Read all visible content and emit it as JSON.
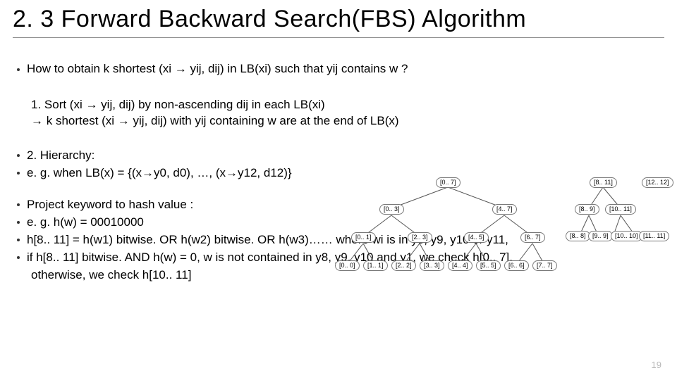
{
  "title": "2. 3 Forward Backward Search(FBS) Algorithm",
  "lead": "How to obtain k shortest (xi → yij, dij) in LB(xi) such that yij contains w ?",
  "para1_line1": "1.  Sort (xi → yij, dij) by non-ascending dij in each LB(xi)",
  "para1_line2": "→ k shortest (xi → yij, dij) with yij containing w are at the end of LB(x)",
  "b1": "2.  Hierarchy:",
  "b2": "e. g. when LB(x) = {(x→y0, d0), …, (x→y12, d12)}",
  "b3": "Project keyword to hash value :",
  "b4": "e. g. h(w) = 00010000",
  "b5": "h[8.. 11] = h(w1) bitwise. OR h(w2) bitwise. OR h(w3)…… where wi is in y8, y9, y10 or y11,",
  "b6": "if h[8.. 11] bitwise. AND h(w) = 0, w is not contained in y8, y9, y10 and y1, we check h[0.. 7],",
  "b6b": "otherwise, we check h[10.. 11]",
  "pagenum": "19",
  "tree1": {
    "n0": "[0.. 7]",
    "n1": "[0.. 3]",
    "n2": "[4.. 7]",
    "n3": "[0.. 1]",
    "n4": "[2.. 3]",
    "n5": "[4.. 5]",
    "n6": "[6.. 7]",
    "n7": "[0.. 0]",
    "n8": "[1.. 1]",
    "n9": "[2.. 2]",
    "n10": "[3.. 3]",
    "n11": "[4.. 4]",
    "n12": "[5.. 5]",
    "n13": "[6.. 6]",
    "n14": "[7.. 7]"
  },
  "tree2": {
    "m0": "[8.. 11]",
    "m1": "[8.. 9]",
    "m2": "[10.. 11]",
    "m3": "[8.. 8]",
    "m4": "[9.. 9]",
    "m5": "[10.. 10]",
    "m6": "[11.. 11]",
    "m7": "[12.. 12]"
  }
}
